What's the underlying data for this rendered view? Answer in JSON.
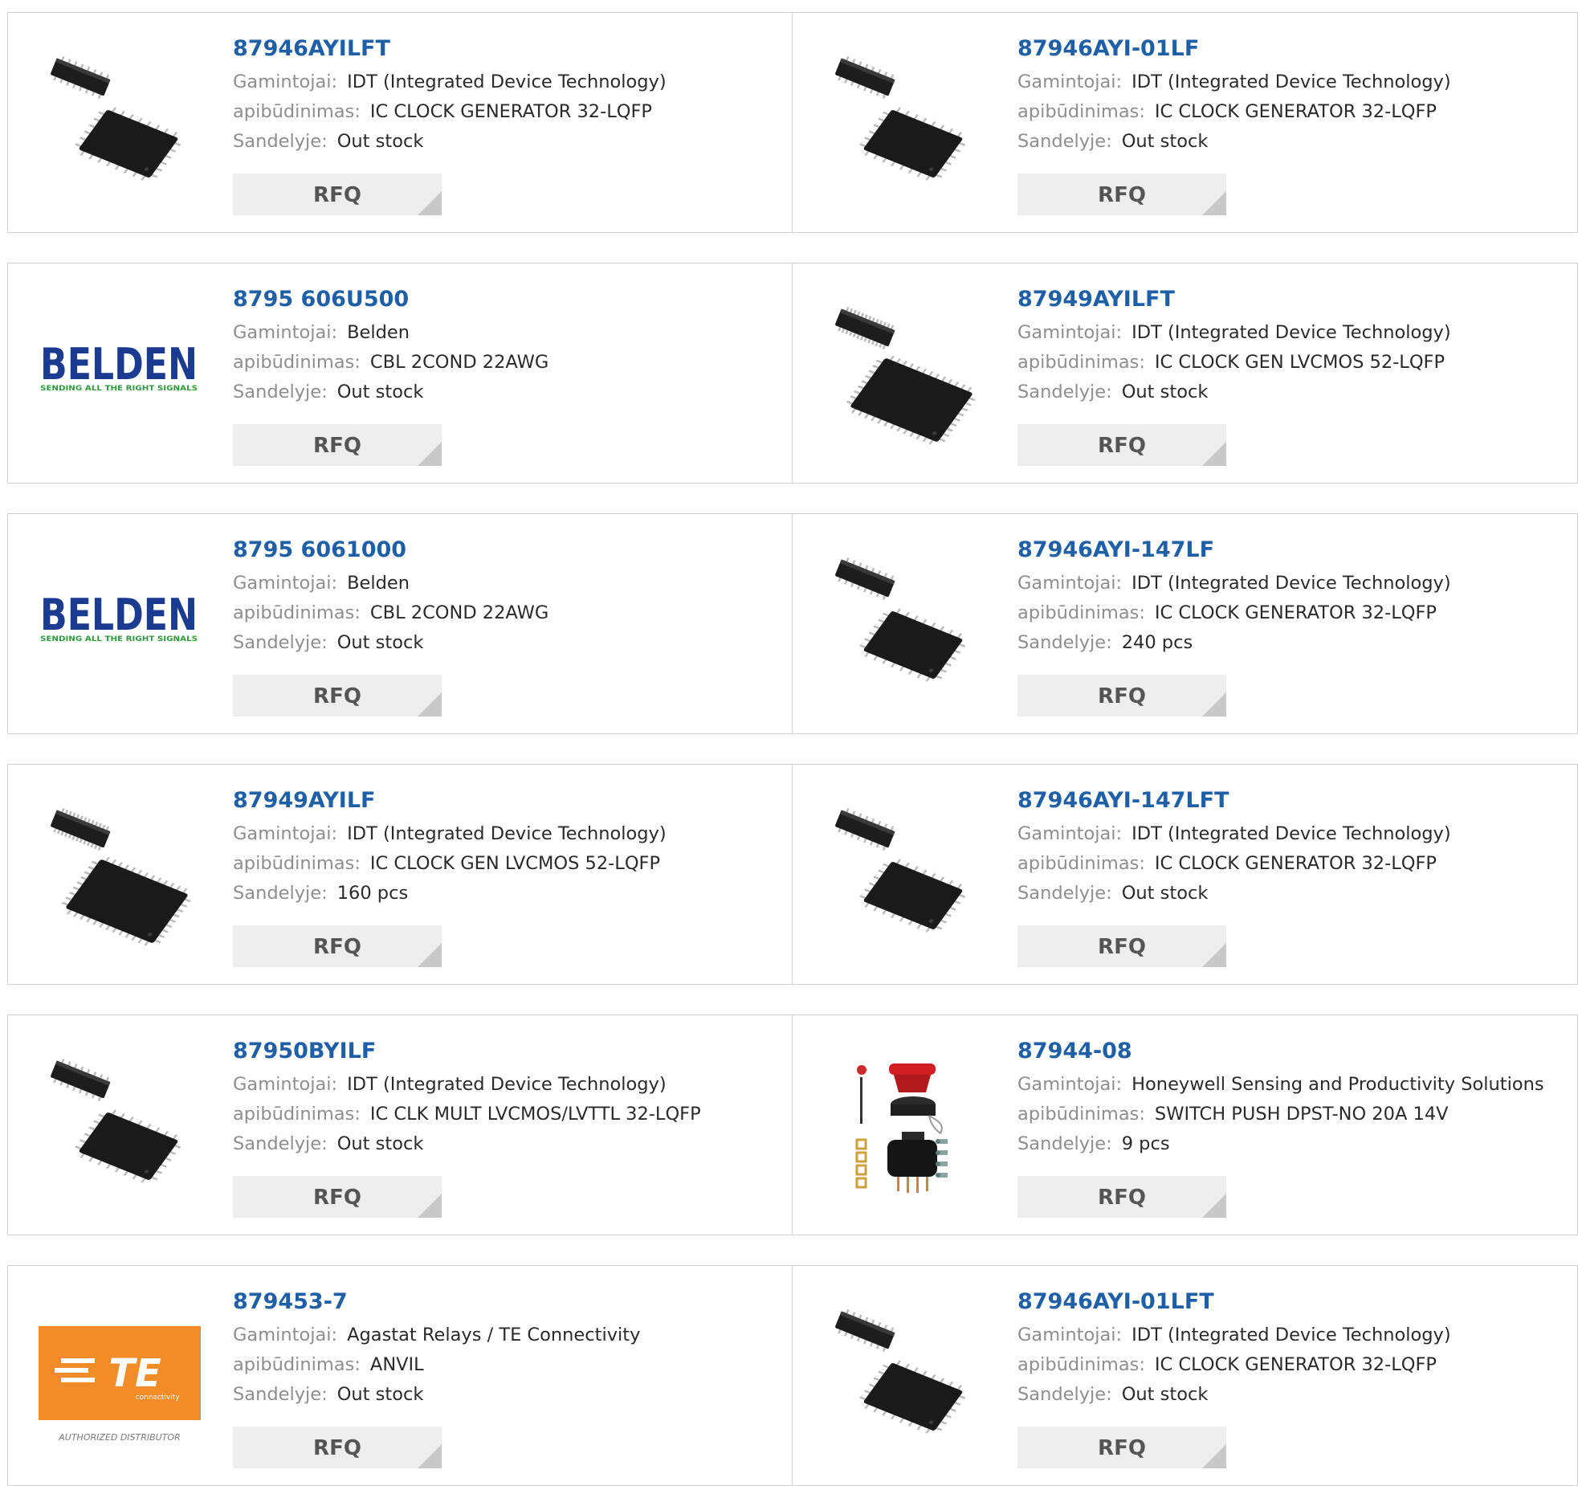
{
  "labels": {
    "manufacturer": "Gamintojai:",
    "description": "apibūdinimas:",
    "stock": "Sandelyje:",
    "rfq": "RFQ"
  },
  "products": [
    {
      "part": "87946AYILFT",
      "manufacturer": "IDT (Integrated Device Technology)",
      "description": "IC CLOCK GENERATOR 32-LQFP",
      "stock": "Out stock",
      "image": "lqfp-32-chip-icon"
    },
    {
      "part": "87946AYI-01LF",
      "manufacturer": "IDT (Integrated Device Technology)",
      "description": "IC CLOCK GENERATOR 32-LQFP",
      "stock": "Out stock",
      "image": "lqfp-32-chip-icon"
    },
    {
      "part": "8795 606U500",
      "manufacturer": "Belden",
      "description": "CBL 2COND 22AWG",
      "stock": "Out stock",
      "image": "belden-logo",
      "logo_text": "BELDEN",
      "logo_tagline": "SENDING ALL THE RIGHT SIGNALS"
    },
    {
      "part": "87949AYILFT",
      "manufacturer": "IDT (Integrated Device Technology)",
      "description": "IC CLOCK GEN LVCMOS 52-LQFP",
      "stock": "Out stock",
      "image": "lqfp-52-chip-icon"
    },
    {
      "part": "8795 6061000",
      "manufacturer": "Belden",
      "description": "CBL 2COND 22AWG",
      "stock": "Out stock",
      "image": "belden-logo",
      "logo_text": "BELDEN",
      "logo_tagline": "SENDING ALL THE RIGHT SIGNALS"
    },
    {
      "part": "87946AYI-147LF",
      "manufacturer": "IDT (Integrated Device Technology)",
      "description": "IC CLOCK GENERATOR 32-LQFP",
      "stock": "240 pcs",
      "image": "lqfp-32-chip-icon"
    },
    {
      "part": "87949AYILF",
      "manufacturer": "IDT (Integrated Device Technology)",
      "description": "IC CLOCK GEN LVCMOS 52-LQFP",
      "stock": "160 pcs",
      "image": "lqfp-52-chip-icon"
    },
    {
      "part": "87946AYI-147LFT",
      "manufacturer": "IDT (Integrated Device Technology)",
      "description": "IC CLOCK GENERATOR 32-LQFP",
      "stock": "Out stock",
      "image": "lqfp-32-chip-icon"
    },
    {
      "part": "87950BYILF",
      "manufacturer": "IDT (Integrated Device Technology)",
      "description": "IC CLK MULT LVCMOS/LVTTL 32-LQFP",
      "stock": "Out stock",
      "image": "lqfp-32-chip-icon"
    },
    {
      "part": "87944-08",
      "manufacturer": "Honeywell Sensing and Productivity Solutions",
      "description": "SWITCH PUSH DPST-NO 20A 14V",
      "stock": "9 pcs",
      "image": "push-switch-icon"
    },
    {
      "part": "879453-7",
      "manufacturer": "Agastat Relays / TE Connectivity",
      "description": "ANVIL",
      "stock": "Out stock",
      "image": "te-connectivity-logo",
      "logo_text": "TE",
      "logo_sub": "connectivity",
      "logo_caption": "AUTHORIZED DISTRIBUTOR"
    },
    {
      "part": "87946AYI-01LFT",
      "manufacturer": "IDT (Integrated Device Technology)",
      "description": "IC CLOCK GENERATOR 32-LQFP",
      "stock": "Out stock",
      "image": "lqfp-32-chip-icon"
    }
  ],
  "colors": {
    "part_link": "#1f5fa6",
    "label_gray": "#8e8e8e",
    "rfq_bg": "#eeeeee",
    "belden_blue": "#1a3b8f",
    "belden_green": "#2e9a3c",
    "te_orange": "#f28c28"
  }
}
